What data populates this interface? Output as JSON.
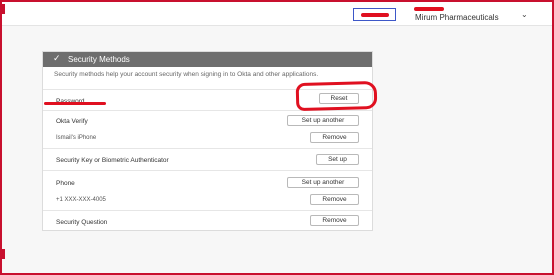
{
  "topbar": {
    "org_name": "Mirum Pharmaceuticals",
    "chevron": "chevron-down-icon"
  },
  "security": {
    "title": "Security Methods",
    "header_icon": "chevron-check-icon",
    "description": "Security methods help your account security when signing in to Okta and other applications.",
    "methods": [
      {
        "label": "Password",
        "button": "Reset"
      },
      {
        "label": "Okta Verify",
        "button": "Set up another",
        "sub_label": "Ismail's iPhone",
        "sub_button": "Remove"
      },
      {
        "label": "Security Key or Biometric Authenticator",
        "button": "Set up"
      },
      {
        "label": "Phone",
        "button": "Set up another",
        "sub_label": "+1 XXX-XXX-4005",
        "sub_button": "Remove"
      },
      {
        "label": "Security Question",
        "button": "Remove"
      }
    ]
  },
  "colors": {
    "frame_border": "#c8102e",
    "annotation_red": "#e01020",
    "header_bg": "#6e6e6e",
    "highlight_box": "#3d57c8"
  }
}
